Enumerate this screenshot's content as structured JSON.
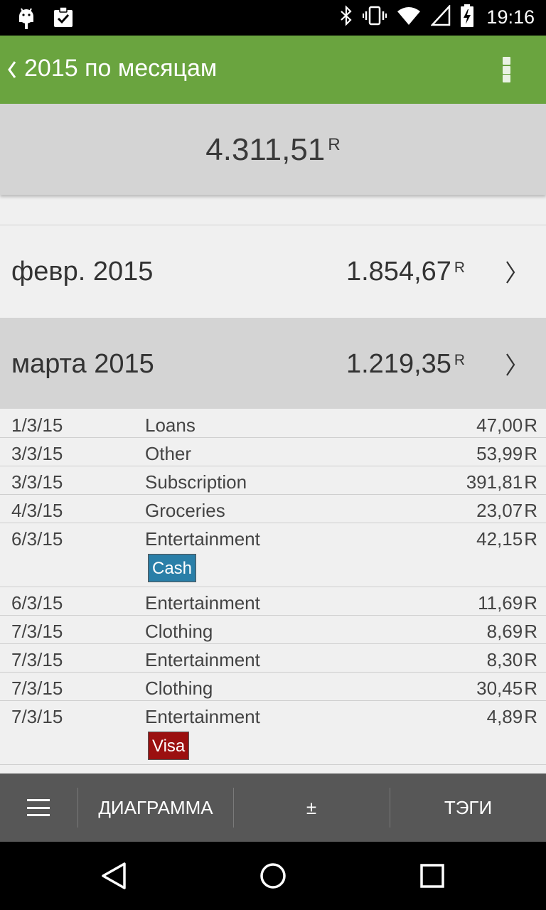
{
  "status_bar": {
    "time": "19:16",
    "icons": [
      "android-debug-icon",
      "clipboard-check-icon",
      "bluetooth-icon",
      "vibrate-icon",
      "wifi-icon",
      "signal-icon",
      "battery-charging-icon"
    ]
  },
  "app_bar": {
    "title": "2015 по месяцам",
    "back_icon": "chevron-left-icon",
    "menu_icon": "more-vert-icon"
  },
  "summary": {
    "total": "4.311,51",
    "currency": "R"
  },
  "months": [
    {
      "name": "февр. 2015",
      "amount": "1.854,67",
      "currency": "R"
    },
    {
      "name": "марта 2015",
      "amount": "1.219,35",
      "currency": "R"
    }
  ],
  "transactions": [
    {
      "date": "1/3/15",
      "category": "Loans",
      "amount": "47,00",
      "currency": "R"
    },
    {
      "date": "3/3/15",
      "category": "Other",
      "amount": "53,99",
      "currency": "R"
    },
    {
      "date": "3/3/15",
      "category": "Subscription",
      "amount": "391,81",
      "currency": "R"
    },
    {
      "date": "4/3/15",
      "category": "Groceries",
      "amount": "23,07",
      "currency": "R"
    },
    {
      "date": "6/3/15",
      "category": "Entertainment",
      "amount": "42,15",
      "currency": "R",
      "tag": "Cash",
      "tag_color": "#2a7fa8"
    },
    {
      "date": "6/3/15",
      "category": "Entertainment",
      "amount": "11,69",
      "currency": "R"
    },
    {
      "date": "7/3/15",
      "category": "Clothing",
      "amount": "8,69",
      "currency": "R"
    },
    {
      "date": "7/3/15",
      "category": "Entertainment",
      "amount": "8,30",
      "currency": "R"
    },
    {
      "date": "7/3/15",
      "category": "Clothing",
      "amount": "30,45",
      "currency": "R"
    },
    {
      "date": "7/3/15",
      "category": "Entertainment",
      "amount": "4,89",
      "currency": "R",
      "tag": "Visa",
      "tag_color": "#9b1010"
    }
  ],
  "toolbar": {
    "menu_icon": "hamburger-menu-icon",
    "chart_label": "ДИАГРАММА",
    "plus_minus_label": "±",
    "tags_label": "ТЭГИ"
  },
  "nav_bar": {
    "icons": [
      "back-triangle-icon",
      "home-circle-icon",
      "recents-square-icon"
    ]
  },
  "colors": {
    "accent": "#6aa43f",
    "toolbar": "#575757",
    "panel": "#d4d4d4",
    "background": "#f0f0f0"
  }
}
